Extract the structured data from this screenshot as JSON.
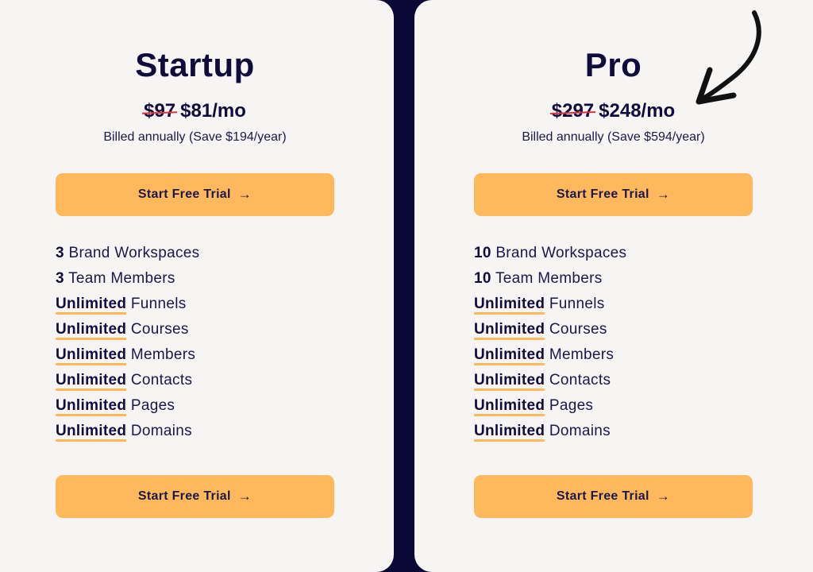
{
  "plans": [
    {
      "name": "Startup",
      "old_price": "$97",
      "price": "$81/mo",
      "billing": "Billed annually (Save $194/year)",
      "cta_label": "Start Free Trial",
      "features": [
        {
          "strong": "3",
          "text": "Brand Workspaces"
        },
        {
          "strong": "3",
          "text": "Team Members"
        },
        {
          "strong": "Unlimited",
          "text": "Funnels"
        },
        {
          "strong": "Unlimited",
          "text": "Courses"
        },
        {
          "strong": "Unlimited",
          "text": "Members"
        },
        {
          "strong": "Unlimited",
          "text": "Contacts"
        },
        {
          "strong": "Unlimited",
          "text": "Pages"
        },
        {
          "strong": "Unlimited",
          "text": "Domains"
        }
      ]
    },
    {
      "name": "Pro",
      "old_price": "$297",
      "price": "$248/mo",
      "billing": "Billed annually (Save $594/year)",
      "cta_label": "Start Free Trial",
      "features": [
        {
          "strong": "10",
          "text": "Brand Workspaces"
        },
        {
          "strong": "10",
          "text": "Team Members"
        },
        {
          "strong": "Unlimited",
          "text": "Funnels"
        },
        {
          "strong": "Unlimited",
          "text": "Courses"
        },
        {
          "strong": "Unlimited",
          "text": "Members"
        },
        {
          "strong": "Unlimited",
          "text": "Contacts"
        },
        {
          "strong": "Unlimited",
          "text": "Pages"
        },
        {
          "strong": "Unlimited",
          "text": "Domains"
        }
      ]
    }
  ],
  "arrow_glyph": "→",
  "colors": {
    "accent": "#ffb85c",
    "navy": "#0f0c3c",
    "strike": "#e0323c",
    "card": "#f6f5f3",
    "background": "#0b0836"
  }
}
